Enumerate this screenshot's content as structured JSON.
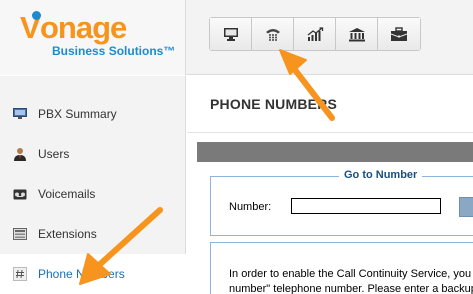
{
  "brand": {
    "logo_name": "vonage",
    "logo_v": "V",
    "logo_rest": "onage",
    "logo_subtitle": "Business Solutions™"
  },
  "toolbar": {
    "buttons": [
      {
        "icon": "monitor-icon"
      },
      {
        "icon": "phone-keypad-icon"
      },
      {
        "icon": "chart-icon"
      },
      {
        "icon": "bank-icon"
      },
      {
        "icon": "briefcase-icon"
      }
    ]
  },
  "sidebar": {
    "items": [
      {
        "label": "PBX Summary",
        "icon": "monitor-small-icon"
      },
      {
        "label": "Users",
        "icon": "user-icon"
      },
      {
        "label": "Voicemails",
        "icon": "voicemail-icon"
      },
      {
        "label": "Extensions",
        "icon": "extensions-icon"
      },
      {
        "label": "Phone Numbers",
        "icon": "hash-icon",
        "active": true
      }
    ]
  },
  "main": {
    "title": "PHONE NUMBERS",
    "goto": {
      "legend": "Go to Number",
      "label": "Number:",
      "value": ""
    },
    "info_line1": "In order to enable the Call Continuity Service, you",
    "info_line2": "number\" telephone number. Please enter a backup"
  },
  "colors": {
    "brand_orange": "#f7941d",
    "brand_blue": "#1a8ccf",
    "arrow_orange": "#f7941d",
    "active_link": "#1a6fb3"
  }
}
